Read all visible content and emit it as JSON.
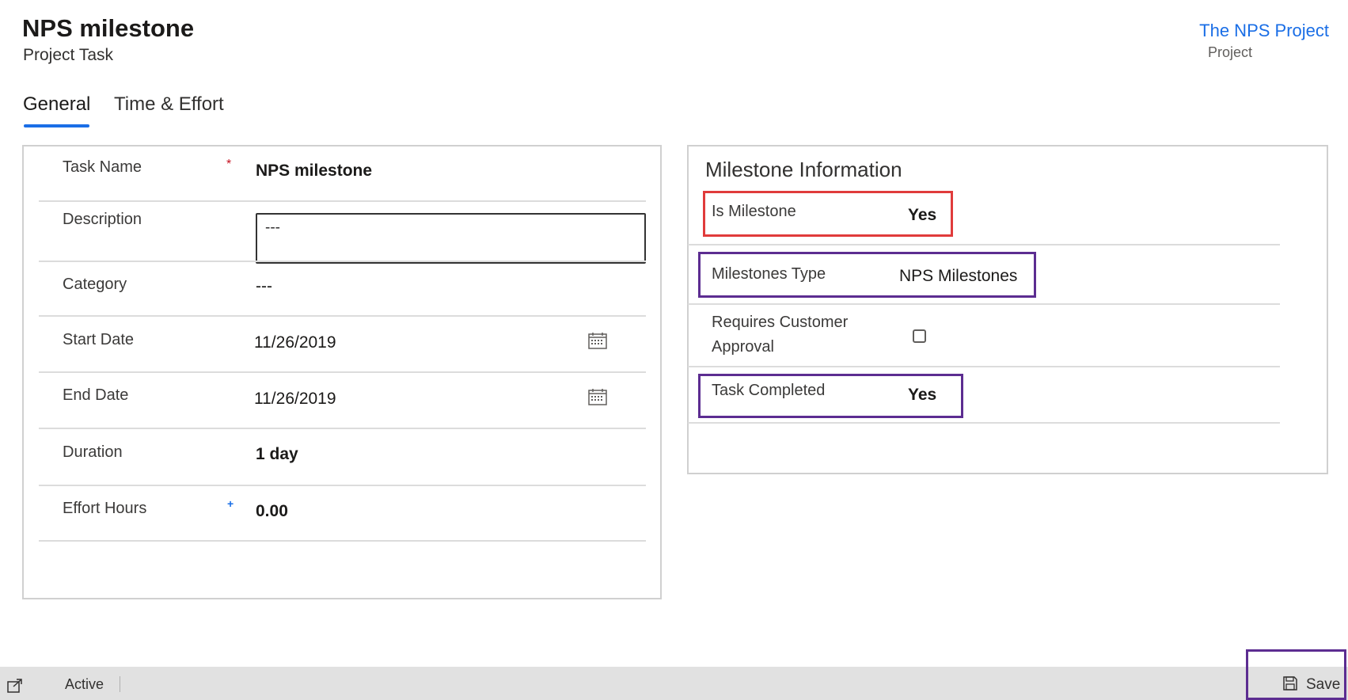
{
  "header": {
    "title": "NPS milestone",
    "subtitle": "Project Task",
    "project_link": "The NPS Project",
    "project_label": "Project"
  },
  "tabs": [
    {
      "label": "General",
      "selected": true
    },
    {
      "label": "Time & Effort",
      "selected": false
    }
  ],
  "general": {
    "task_name": {
      "label": "Task Name",
      "required_marker": "*",
      "value": "NPS milestone"
    },
    "description": {
      "label": "Description",
      "value": "---"
    },
    "category": {
      "label": "Category",
      "value": "---"
    },
    "start_date": {
      "label": "Start Date",
      "value": "11/26/2019",
      "icon": "calendar-icon"
    },
    "end_date": {
      "label": "End Date",
      "value": "11/26/2019",
      "icon": "calendar-icon"
    },
    "duration": {
      "label": "Duration",
      "value": "1 day"
    },
    "effort_hours": {
      "label": "Effort Hours",
      "recommended_marker": "+",
      "value": "0.00"
    }
  },
  "milestone": {
    "section_title": "Milestone Information",
    "is_milestone": {
      "label": "Is Milestone",
      "value": "Yes"
    },
    "milestones_type": {
      "label": "Milestones Type",
      "value": "NPS Milestones"
    },
    "requires_customer_approval": {
      "label_line1": "Requires Customer",
      "label_line2": "Approval",
      "checked": false
    },
    "task_completed": {
      "label": "Task Completed",
      "value": "Yes"
    }
  },
  "statusbar": {
    "status": "Active",
    "save_label": "Save",
    "expand_icon": "open-in-window-icon",
    "save_icon": "floppy-disk-icon"
  },
  "colors": {
    "accent": "#1a6ee6",
    "highlight_red": "#e03b3b",
    "highlight_purple": "#5c2d91",
    "statusbar_bg": "#e1e1e1"
  }
}
